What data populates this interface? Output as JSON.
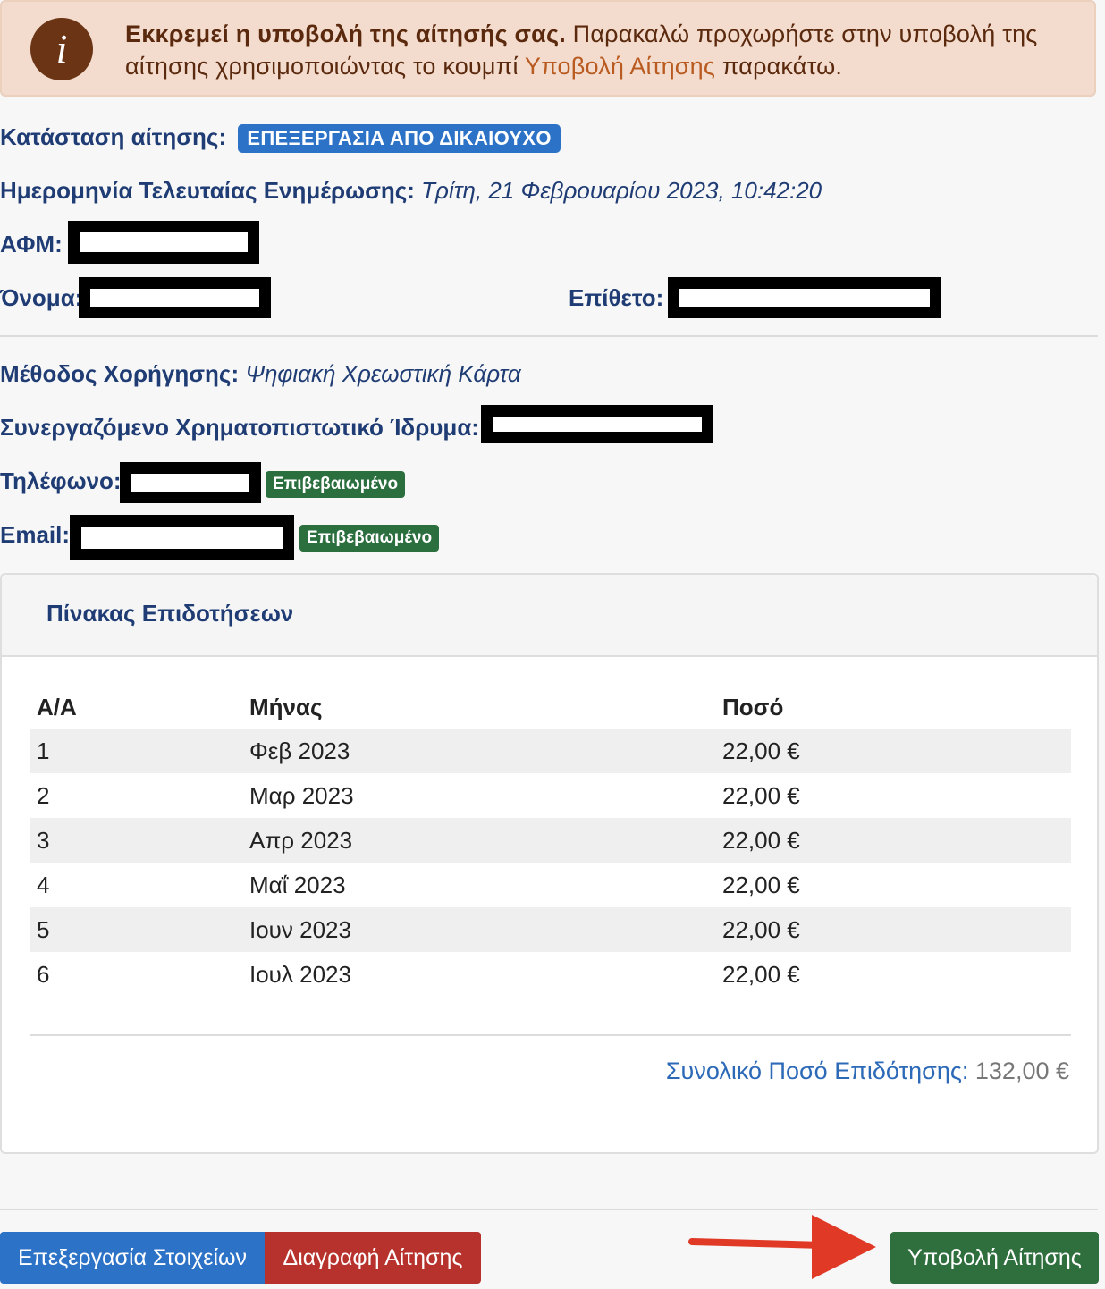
{
  "alert": {
    "icon": "info-icon",
    "bold_text": "Εκκρεμεί η υποβολή της αίτησής σας.",
    "text_before_link": " Παρακαλώ προχωρήστε στην υποβολή της αίτησης χρησιμοποιώντας το κουμπί ",
    "link_text": "Υποβολή Αίτησης",
    "text_after_link": " παρακάτω."
  },
  "status": {
    "label": "Κατάσταση αίτησης:",
    "value": "ΕΠΕΞΕΡΓΑΣΙΑ ΑΠΟ ΔΙΚΑΙΟΥΧΟ"
  },
  "last_update": {
    "label": "Ημερομηνία Τελευταίας Ενημέρωσης:",
    "value": "Τρίτη, 21 Φεβρουαρίου 2023, 10:42:20"
  },
  "afm": {
    "label": "ΑΦΜ:"
  },
  "first_name": {
    "label": "Όνομα:"
  },
  "last_name": {
    "label": "Επίθετο:"
  },
  "method": {
    "label": "Μέθοδος Χορήγησης:",
    "value": "Ψηφιακή Χρεωστική Κάρτα"
  },
  "bank": {
    "label": "Συνεργαζόμενο Χρηματοπιστωτικό Ίδρυμα:"
  },
  "phone": {
    "label": "Τηλέφωνο:",
    "badge": "Επιβεβαιωμένο"
  },
  "email": {
    "label": "Email:",
    "badge": "Επιβεβαιωμένο"
  },
  "grants_panel": {
    "title": "Πίνακας Επιδοτήσεων",
    "columns": [
      "Α/Α",
      "Μήνας",
      "Ποσό"
    ],
    "rows": [
      [
        "1",
        "Φεβ 2023",
        "22,00 €"
      ],
      [
        "2",
        "Μαρ 2023",
        "22,00 €"
      ],
      [
        "3",
        "Απρ 2023",
        "22,00 €"
      ],
      [
        "4",
        "Μαΐ 2023",
        "22,00 €"
      ],
      [
        "5",
        "Ιουν 2023",
        "22,00 €"
      ],
      [
        "6",
        "Ιουλ 2023",
        "22,00 €"
      ]
    ],
    "total_label": "Συνολικό Ποσό Επιδότησης:",
    "total_value": "132,00 €"
  },
  "buttons": {
    "edit": "Επεξεργασία Στοιχείων",
    "delete": "Διαγραφή Αίτησης",
    "submit": "Υποβολή Αίτησης"
  },
  "colors": {
    "primary": "#2c72c6",
    "danger": "#b8322d",
    "success": "#2e6f3d",
    "alert_bg": "#f3dccd",
    "annotation_arrow": "#e03a27"
  }
}
